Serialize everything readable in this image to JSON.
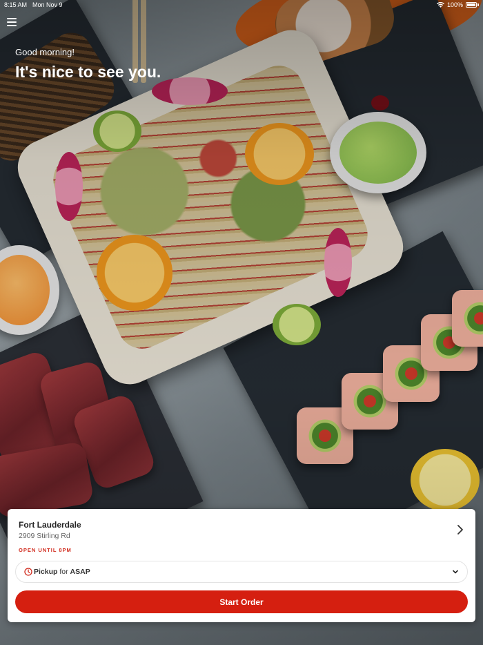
{
  "status_bar": {
    "time": "8:15 AM",
    "date": "Mon Nov 9",
    "battery": "100%"
  },
  "header": {
    "menu_icon": "hamburger-menu-icon",
    "greeting": "Good morning!",
    "headline": "It's nice to see you."
  },
  "order_card": {
    "location_name": "Fort Lauderdale",
    "location_address": "2909 Stirling Rd",
    "open_status": "OPEN UNTIL 8PM",
    "pickup": {
      "mode": "Pickup",
      "connector": "for",
      "time": "ASAP"
    },
    "start_button": "Start Order"
  },
  "colors": {
    "accent": "#d51f10",
    "status_red": "#d12a1c",
    "card_bg": "#ffffff"
  }
}
